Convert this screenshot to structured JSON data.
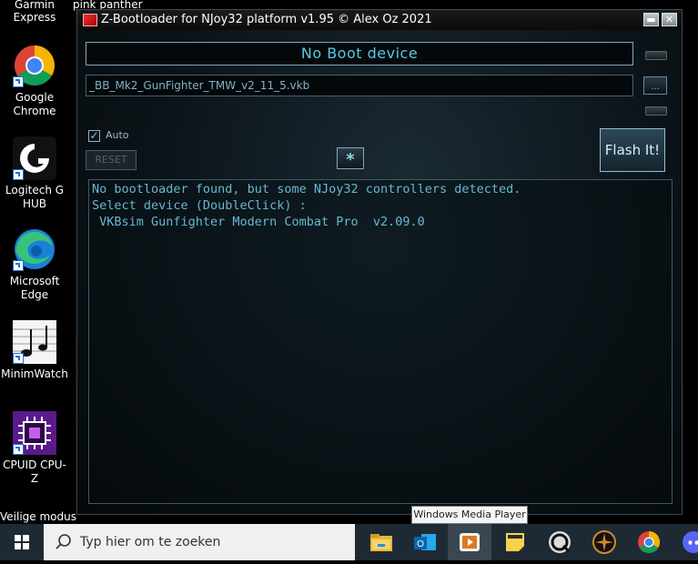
{
  "desktop": {
    "top_partial_labels": [
      "Garmin",
      "Express",
      "pink panther"
    ],
    "icons": [
      {
        "name": "Google Chrome",
        "line1": "Google",
        "line2": "Chrome"
      },
      {
        "name": "Logitech G HUB",
        "line1": "Logitech G",
        "line2": "HUB"
      },
      {
        "name": "Microsoft Edge",
        "line1": "Microsoft",
        "line2": "Edge"
      },
      {
        "name": "MinimWatch",
        "line1": "MinimWatch",
        "line2": ""
      },
      {
        "name": "CPUID CPU-Z",
        "line1": "CPUID CPU-Z",
        "line2": ""
      }
    ],
    "bottom_partial_label": "Veilige modus"
  },
  "window": {
    "title": "Z-Bootloader for NJoy32 platform v1.95 © Alex Oz 2021",
    "minimize_label": "▬",
    "close_label": "✕",
    "boot_status": "No Boot device",
    "file_name": "_BB_Mk2_GunFighter_TMW_v2_11_5.vkb",
    "browse_label": "...",
    "auto_label": "Auto",
    "auto_checked": true,
    "reset_label": "RESET",
    "star_label": "*",
    "flash_label": "Flash It!",
    "log_lines": [
      "No bootloader found, but some NJoy32 controllers detected.",
      "Select device (DoubleClick) :",
      "",
      " VKBsim Gunfighter Modern Combat Pro  v2.09.0"
    ]
  },
  "tooltip": "Windows Media Player",
  "taskbar": {
    "search_placeholder": "Typ hier om te zoeken",
    "apps": [
      "file-explorer-icon",
      "outlook-icon",
      "windows-media-player-icon",
      "sticky-notes-icon",
      "quicktime-icon",
      "compass-app-icon",
      "chrome-icon",
      "discord-icon"
    ]
  },
  "colors": {
    "accent": "#59c9e3",
    "log_text": "#66b8d4"
  }
}
